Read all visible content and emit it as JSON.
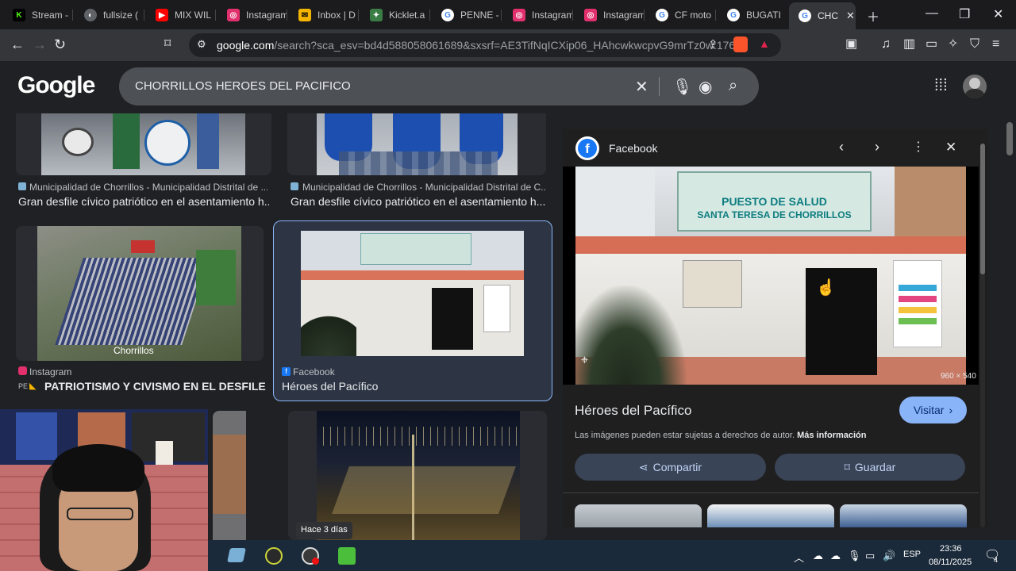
{
  "tabs": [
    {
      "label": "Stream -",
      "icon": "kick-icon",
      "color": "#53fc18"
    },
    {
      "label": "fullsize (",
      "icon": "globe-icon",
      "color": "#9aa0a6"
    },
    {
      "label": "MIX WIL",
      "icon": "youtube-icon",
      "color": "#ff0000"
    },
    {
      "label": "Instagram",
      "icon": "instagram-icon",
      "color": "#e1306c"
    },
    {
      "label": "Inbox | D",
      "icon": "mail-icon",
      "color": "#f4b400"
    },
    {
      "label": "Kicklet.a",
      "icon": "kicklet-icon",
      "color": "#3a7d44"
    },
    {
      "label": "PENNE -",
      "icon": "google-icon",
      "color": "#4285f4"
    },
    {
      "label": "Instagram",
      "icon": "instagram-icon",
      "color": "#e1306c"
    },
    {
      "label": "Instagram",
      "icon": "instagram-icon",
      "color": "#e1306c"
    },
    {
      "label": "CF moto",
      "icon": "google-icon",
      "color": "#4285f4"
    },
    {
      "label": "BUGATI",
      "icon": "google-icon",
      "color": "#4285f4"
    },
    {
      "label": "CHC",
      "icon": "google-icon",
      "color": "#4285f4"
    }
  ],
  "toolbar": {
    "url_domain": "google.com",
    "url_rest": "/search?sca_esv=bd4d588058061689&sxsrf=AE3TifNqICXip06_HAhcwkwcpvG9mrTz0w:176..."
  },
  "search": {
    "logo": "Google",
    "query": "CHORRILLOS HEROES DEL PACIFICO"
  },
  "results": [
    {
      "source": "Municipalidad de Chorrillos - Municipalidad Distrital de ...",
      "title": "Gran desfile cívico patriótico en el asentamiento h..."
    },
    {
      "source": "Municipalidad de Chorrillos - Municipalidad Distrital de C...",
      "title": "Gran desfile cívico patriótico en el asentamiento h..."
    },
    {
      "source": "Instagram",
      "title": "PATRIOTISMO Y CIVISMO EN EL DESFILE E...",
      "prefix": "PE",
      "overlay": "Chorrillos"
    },
    {
      "source": "Facebook",
      "title": "Héroes del Pacífico"
    },
    {
      "badge": "Hace 3 días"
    }
  ],
  "panel": {
    "source": "Facebook",
    "image_size": "960 × 540",
    "sign_line1": "PUESTO DE SALUD",
    "sign_line2": "SANTA TERESA DE CHORRILLOS",
    "title": "Héroes del Pacífico",
    "visit_label": "Visitar",
    "copyright": "Las imágenes pueden estar sujetas a derechos de autor.",
    "more_info": "Más información",
    "share_label": "Compartir",
    "save_label": "Guardar"
  },
  "taskbar": {
    "lang": "ESP",
    "time": "23:36",
    "date": "08/11/2025",
    "notif": "4"
  }
}
